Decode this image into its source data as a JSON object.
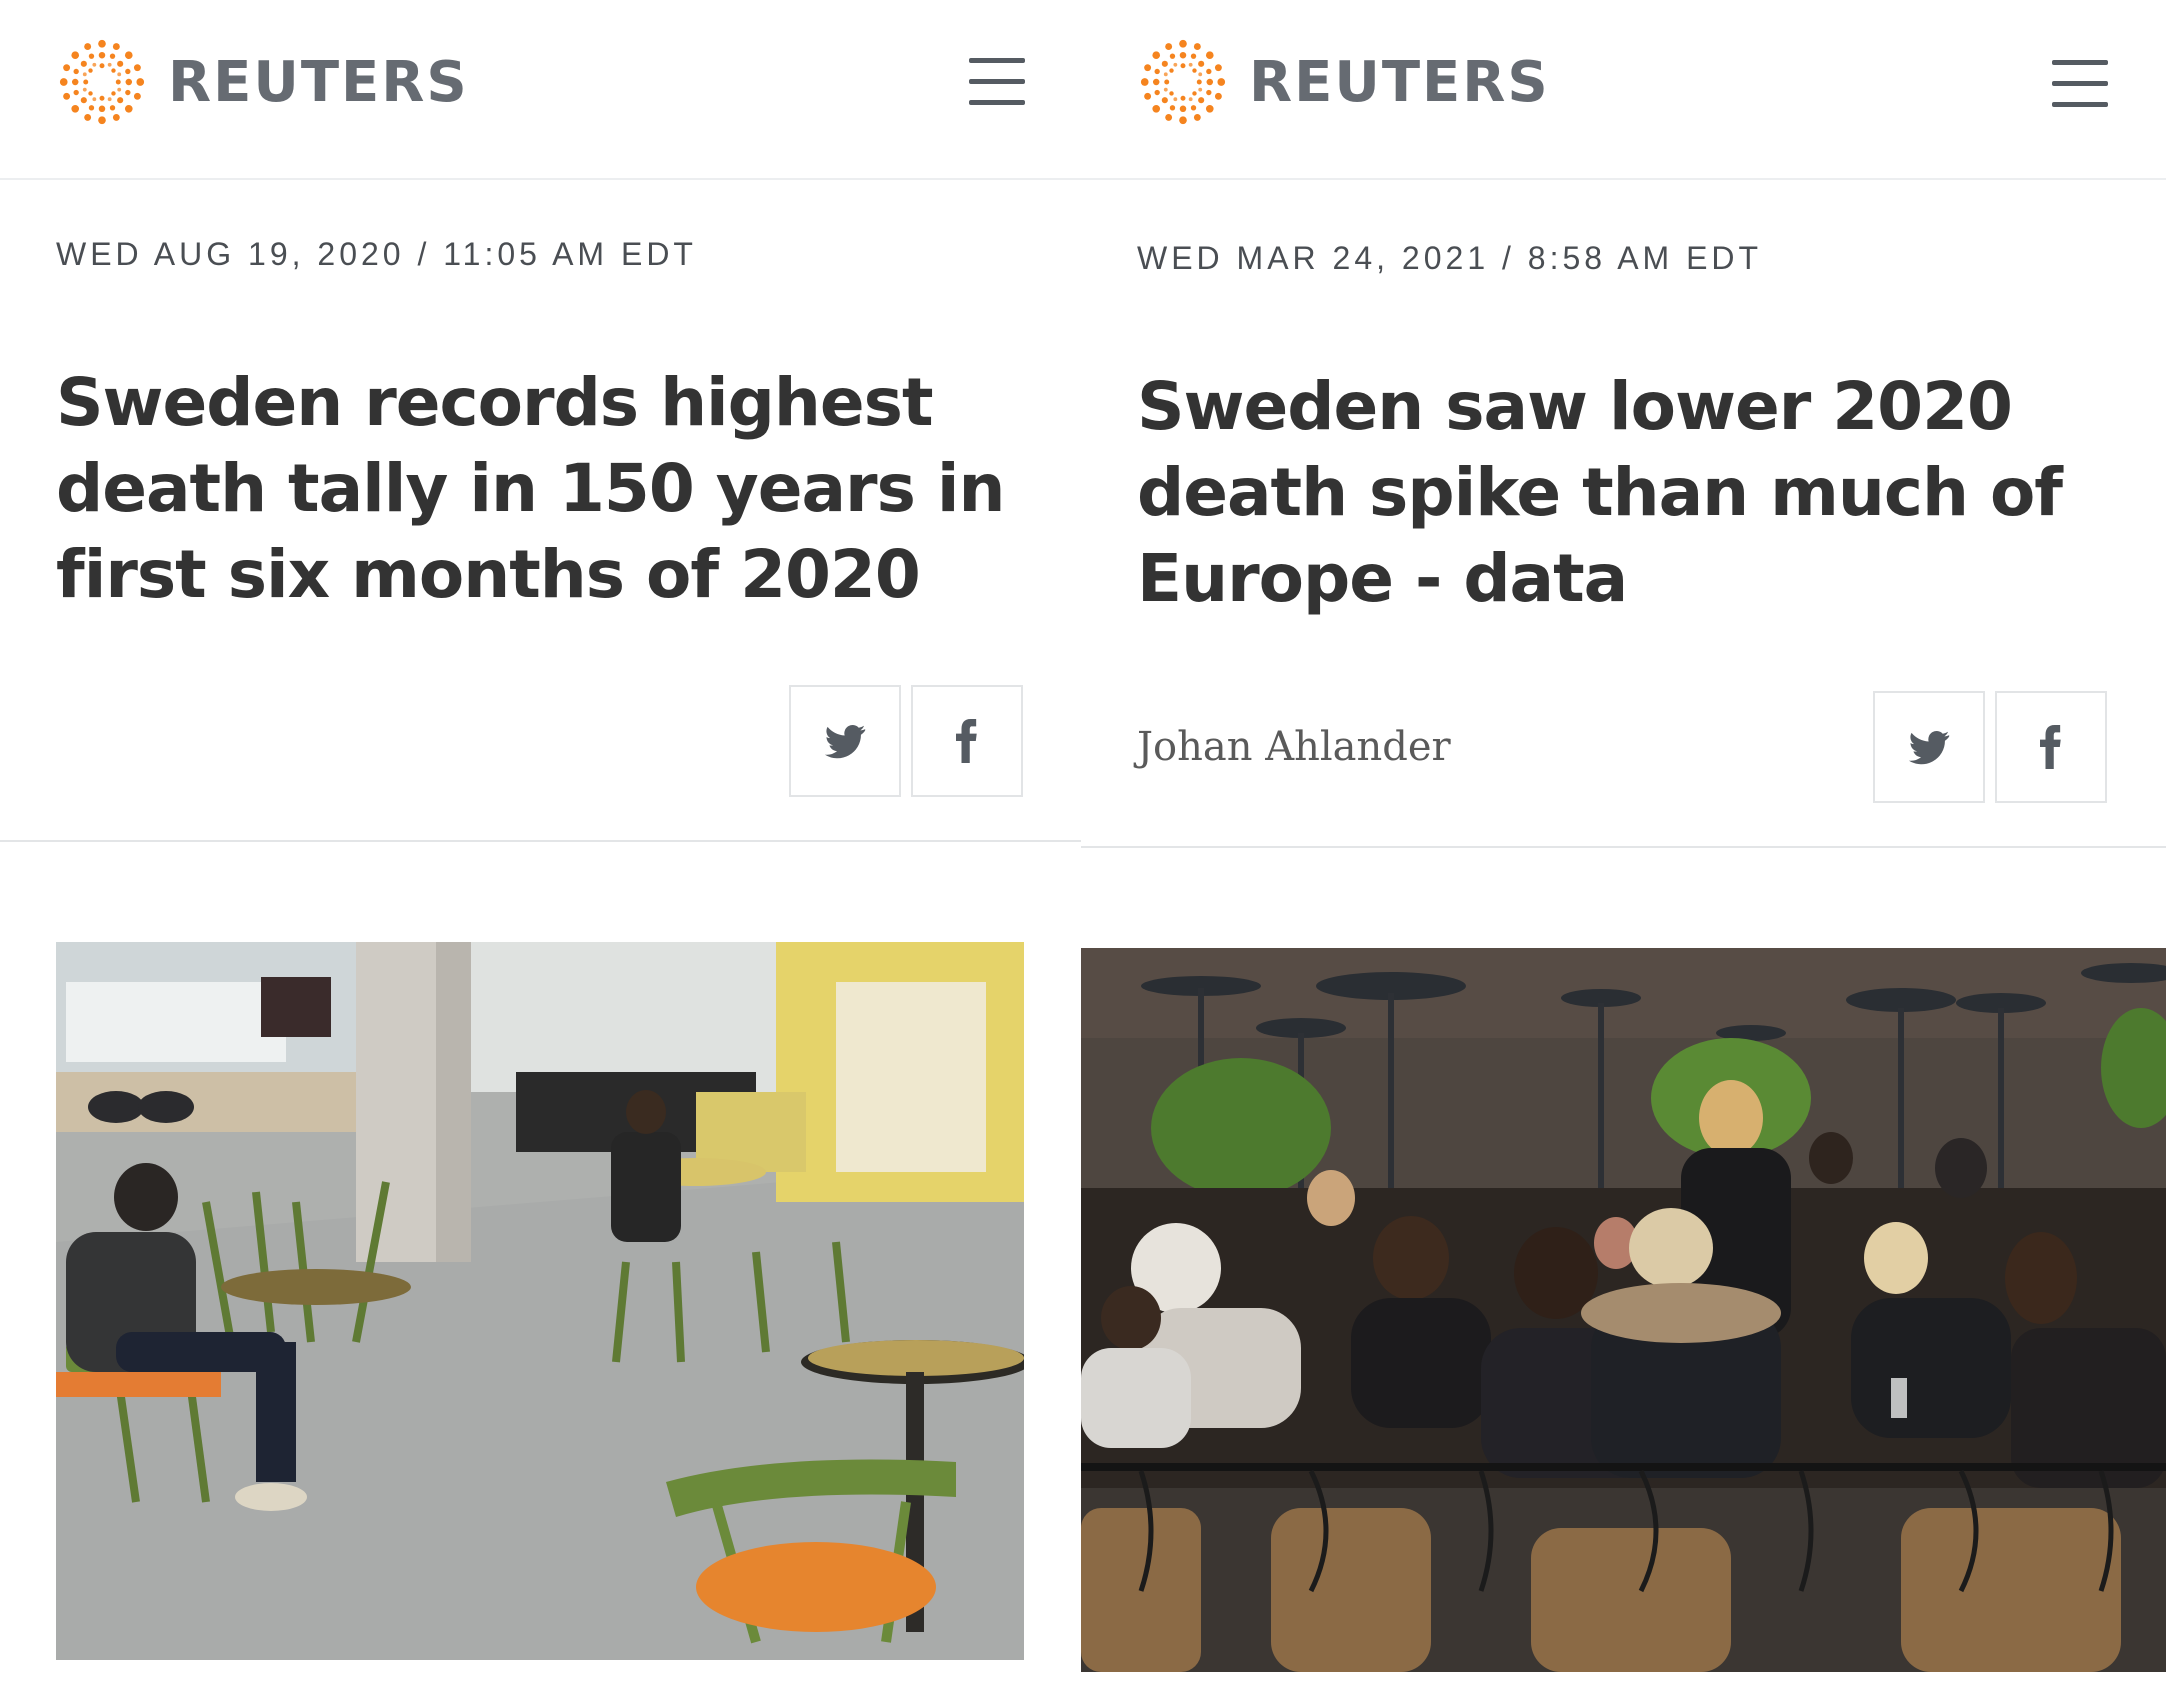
{
  "left": {
    "brand": "REUTERS",
    "dateline": "WED AUG 19, 2020 / 11:05 AM EDT",
    "headline": "Sweden records highest death tally in 150 years in first six months of 2020",
    "share": {
      "twitter_icon": "twitter-icon",
      "facebook_icon": "facebook-icon"
    },
    "photo": "empty-cafe-photo"
  },
  "right": {
    "brand": "REUTERS",
    "dateline": "WED MAR 24, 2021 / 8:58 AM EDT",
    "headline": "Sweden saw lower 2020 death spike than much of Europe - data",
    "byline": "Johan Ahlander",
    "share": {
      "twitter_icon": "twitter-icon",
      "facebook_icon": "facebook-icon"
    },
    "photo": "crowded-outdoor-cafe-photo"
  },
  "colors": {
    "brand_orange": "#f28c28",
    "logo_text": "#666b72",
    "headline": "#333333",
    "divider": "#e3e5e7"
  }
}
